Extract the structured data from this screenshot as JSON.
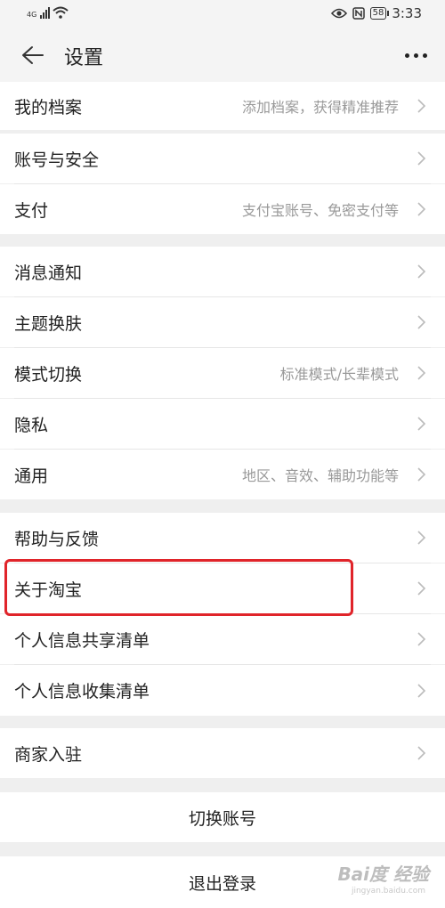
{
  "status_bar": {
    "network": "4G",
    "time": "3:33",
    "battery": "58",
    "icons": [
      "signal-icon",
      "wifi-icon",
      "eye-icon",
      "nfc-icon",
      "battery-icon"
    ]
  },
  "header": {
    "title": "设置",
    "back_icon": "arrow-left-icon",
    "more_icon": "more-dots-icon"
  },
  "groups": [
    {
      "items": [
        {
          "label": "我的档案",
          "value": "添加档案，获得精准推荐"
        }
      ]
    },
    {
      "items": [
        {
          "label": "账号与安全",
          "value": ""
        },
        {
          "label": "支付",
          "value": "支付宝账号、免密支付等"
        }
      ]
    },
    {
      "items": [
        {
          "label": "消息通知",
          "value": ""
        },
        {
          "label": "主题换肤",
          "value": ""
        },
        {
          "label": "模式切换",
          "value": "标准模式/长辈模式"
        },
        {
          "label": "隐私",
          "value": ""
        },
        {
          "label": "通用",
          "value": "地区、音效、辅助功能等"
        }
      ]
    },
    {
      "items": [
        {
          "label": "帮助与反馈",
          "value": ""
        },
        {
          "label": "关于淘宝",
          "value": "",
          "highlighted": true
        },
        {
          "label": "个人信息共享清单",
          "value": ""
        },
        {
          "label": "个人信息收集清单",
          "value": ""
        }
      ]
    },
    {
      "items": [
        {
          "label": "商家入驻",
          "value": ""
        }
      ]
    }
  ],
  "actions": {
    "switch_account": "切换账号",
    "logout": "退出登录"
  },
  "watermark": {
    "brand": "Bai度 经验",
    "url": "jingyan.baidu.com"
  },
  "colors": {
    "highlight": "#e0242a",
    "background": "#efefef",
    "row": "#ffffff",
    "secondary_text": "#999999"
  }
}
